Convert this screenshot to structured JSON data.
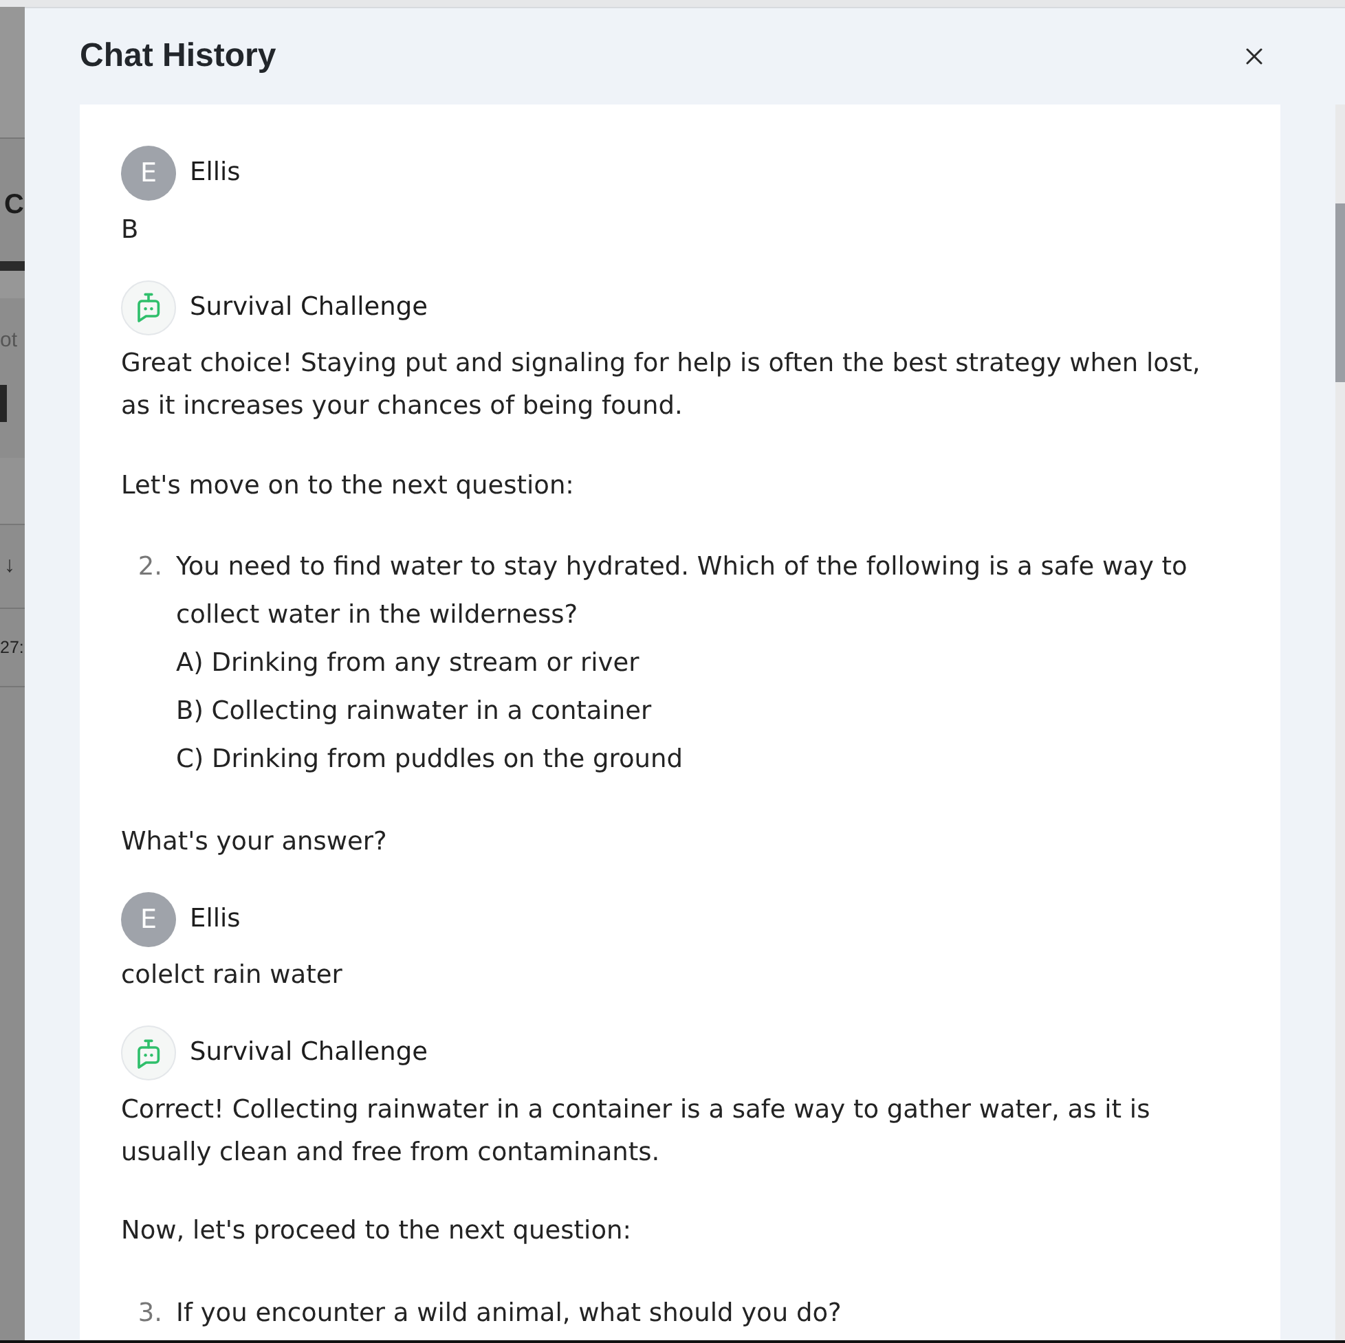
{
  "background_page": {
    "title_fragment": "C",
    "label_fragment": "ot",
    "arrow": "↓",
    "cell_fragment": "27:"
  },
  "dialog": {
    "title": "Chat History"
  },
  "messages": [
    {
      "kind": "user",
      "sender": "Ellis",
      "avatar_letter": "E",
      "blocks": [
        {
          "kind": "paragraph",
          "text": "B"
        }
      ]
    },
    {
      "kind": "bot",
      "sender": "Survival Challenge",
      "blocks": [
        {
          "kind": "paragraph",
          "text": "Great choice! Staying put and signaling for help is often the best strategy when lost, as it increases your chances of being found."
        },
        {
          "kind": "paragraph",
          "text": "Let's move on to the next question:"
        },
        {
          "kind": "list_item",
          "number": "2.",
          "question": "You need to find water to stay hydrated. Which of the following is a safe way to collect water in the wilderness?",
          "options": [
            "A) Drinking from any stream or river",
            "B) Collecting rainwater in a container",
            "C) Drinking from puddles on the ground"
          ]
        },
        {
          "kind": "paragraph",
          "text": "What's your answer?"
        }
      ]
    },
    {
      "kind": "user",
      "sender": "Ellis",
      "avatar_letter": "E",
      "blocks": [
        {
          "kind": "paragraph",
          "text": "colelct rain water"
        }
      ]
    },
    {
      "kind": "bot",
      "sender": "Survival Challenge",
      "blocks": [
        {
          "kind": "paragraph",
          "text": "Correct! Collecting rainwater in a container is a safe way to gather water, as it is usually clean and free from contaminants."
        },
        {
          "kind": "paragraph",
          "text": "Now, let's proceed to the next question:"
        },
        {
          "kind": "list_item",
          "number": "3.",
          "question": "If you encounter a wild animal, what should you do?"
        }
      ]
    }
  ]
}
